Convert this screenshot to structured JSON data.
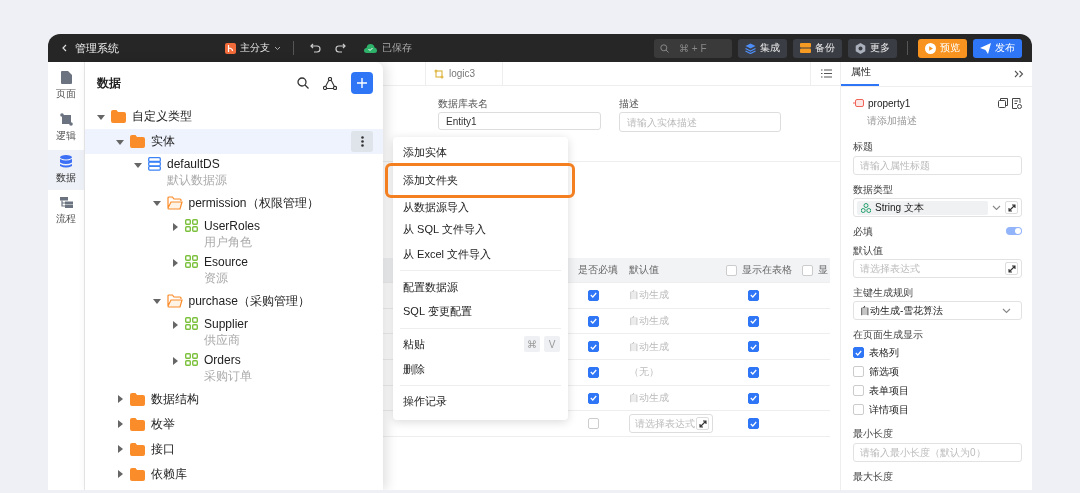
{
  "topbar": {
    "back_label": "管理系统",
    "branch": "主分支",
    "save_status": "已保存",
    "search_shortcut": "⌘ + F",
    "buttons": [
      {
        "label": "集成",
        "kind": "integrate"
      },
      {
        "label": "备份",
        "kind": "backup"
      },
      {
        "label": "更多",
        "kind": "more"
      },
      {
        "label": "预览",
        "kind": "preview"
      },
      {
        "label": "发布",
        "kind": "publish"
      }
    ]
  },
  "rail": [
    {
      "label": "页面",
      "kind": "page",
      "selected": false
    },
    {
      "label": "逻辑",
      "kind": "logic",
      "selected": false
    },
    {
      "label": "数据",
      "kind": "data",
      "selected": true
    },
    {
      "label": "流程",
      "kind": "flow",
      "selected": false
    }
  ],
  "editor": {
    "tab": "logic3",
    "fields": [
      {
        "label": "数据库表名",
        "value": "Entity1"
      },
      {
        "label": "描述",
        "placeholder": "请输入实体描述"
      }
    ],
    "table": {
      "columns": [
        {
          "label": "是否必填",
          "kind": "text"
        },
        {
          "label": "默认值",
          "kind": "text"
        },
        {
          "label": "显示在表格",
          "kind": "checkbox",
          "checked": false
        },
        {
          "label": "显",
          "kind": "checkbox",
          "checked": false
        }
      ],
      "rows": [
        {
          "required": true,
          "default": {
            "kind": "text",
            "text": "自动生成"
          },
          "show": true
        },
        {
          "required": true,
          "default": {
            "kind": "text",
            "text": "自动生成"
          },
          "show": true
        },
        {
          "required": true,
          "default": {
            "kind": "text",
            "text": "自动生成"
          },
          "show": true
        },
        {
          "required": true,
          "default": {
            "kind": "text",
            "text": "（无）"
          },
          "show": true
        },
        {
          "required": true,
          "default": {
            "kind": "text",
            "text": "自动生成"
          },
          "show": true
        },
        {
          "required": false,
          "default": {
            "kind": "field",
            "placeholder": "请选择表达式"
          },
          "show": true
        }
      ]
    }
  },
  "data_panel": {
    "title": "数据",
    "tree": [
      {
        "label": "自定义类型",
        "kind": "folder",
        "expanded": true,
        "selected": false,
        "children": [
          {
            "label": "实体",
            "kind": "folder",
            "expanded": true,
            "selected": true,
            "children": [
              {
                "label": "defaultDS",
                "subtitle": "默认数据源",
                "kind": "database",
                "expanded": true,
                "selected": false,
                "children": [
                  {
                    "label": "permission（权限管理）",
                    "kind": "module",
                    "expanded": true,
                    "selected": false,
                    "children": [
                      {
                        "label": "UserRoles",
                        "subtitle": "用户角色",
                        "kind": "entity",
                        "expanded": false,
                        "selected": false
                      },
                      {
                        "label": "Esource",
                        "subtitle": "资源",
                        "kind": "entity",
                        "expanded": false,
                        "selected": false
                      }
                    ]
                  },
                  {
                    "label": "purchase（采购管理）",
                    "kind": "module",
                    "expanded": true,
                    "selected": false,
                    "children": [
                      {
                        "label": "Supplier",
                        "subtitle": "供应商",
                        "kind": "entity",
                        "expanded": false,
                        "selected": false
                      },
                      {
                        "label": "Orders",
                        "subtitle": "采购订单",
                        "kind": "entity",
                        "expanded": false,
                        "selected": false
                      }
                    ]
                  }
                ]
              }
            ]
          },
          {
            "label": "数据结构",
            "kind": "folder",
            "expanded": false,
            "selected": false
          },
          {
            "label": "枚举",
            "kind": "folder",
            "expanded": false,
            "selected": false
          },
          {
            "label": "接口",
            "kind": "folder",
            "expanded": false,
            "selected": false
          },
          {
            "label": "依赖库",
            "kind": "folder",
            "expanded": false,
            "selected": false
          }
        ]
      }
    ]
  },
  "context_menu": {
    "groups": [
      [
        {
          "label": "添加实体",
          "highlighted": false
        },
        {
          "label": "添加文件夹",
          "highlighted": true
        },
        {
          "label": "从数据源导入",
          "highlighted": false
        },
        {
          "label": "从 SQL 文件导入",
          "highlighted": false
        },
        {
          "label": "从 Excel 文件导入",
          "highlighted": false
        }
      ],
      [
        {
          "label": "配置数据源",
          "highlighted": false
        },
        {
          "label": "SQL 变更配置",
          "highlighted": false
        }
      ],
      [
        {
          "label": "粘贴",
          "highlighted": false,
          "shortcut": [
            "⌘",
            "V"
          ]
        },
        {
          "label": "删除",
          "highlighted": false
        }
      ],
      [
        {
          "label": "操作记录",
          "highlighted": false
        }
      ]
    ]
  },
  "properties": {
    "tab": "属性",
    "name": "property1",
    "description_placeholder": "请添加描述",
    "fields": [
      {
        "kind": "text_input",
        "label": "标题",
        "placeholder": "请输入属性标题"
      },
      {
        "kind": "type_select",
        "label": "数据类型",
        "value": "String 文本"
      },
      {
        "kind": "switch",
        "label": "必填",
        "on": true
      },
      {
        "kind": "expression_input",
        "label": "默认值",
        "placeholder": "请选择表达式"
      },
      {
        "kind": "select",
        "label": "主键生成规则",
        "value": "自动生成-雪花算法"
      },
      {
        "kind": "checkbox_group",
        "label": "在页面生成显示",
        "options": [
          {
            "label": "表格列",
            "checked": true
          },
          {
            "label": "筛选项",
            "checked": false
          },
          {
            "label": "表单项目",
            "checked": false
          },
          {
            "label": "详情项目",
            "checked": false
          }
        ]
      },
      {
        "kind": "text_input",
        "label": "最小长度",
        "placeholder": "请输入最小长度（默认为0）"
      },
      {
        "kind": "label",
        "label": "最大长度"
      }
    ]
  }
}
